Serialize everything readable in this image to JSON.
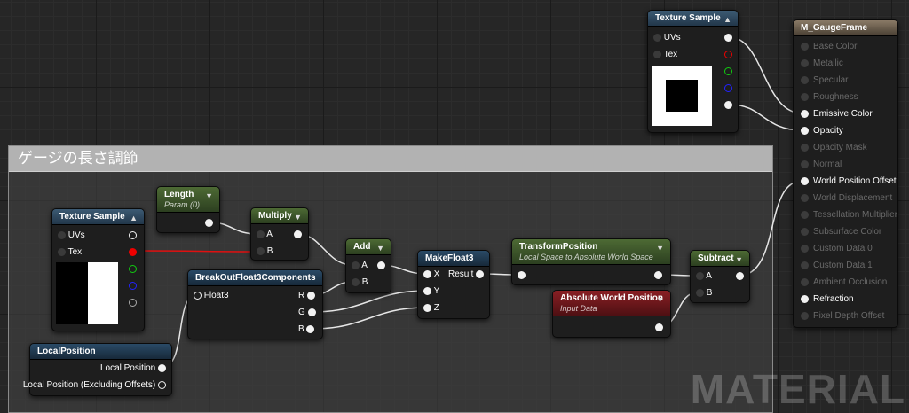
{
  "comment": {
    "title": "ゲージの長さ調節"
  },
  "watermark": "MATERIAL",
  "nodes": {
    "tex_top": {
      "title": "Texture Sample",
      "uvs": "UVs",
      "tex": "Tex"
    },
    "tex_left": {
      "title": "Texture Sample",
      "uvs": "UVs",
      "tex": "Tex"
    },
    "length": {
      "title": "Length",
      "subtitle": "Param (0)"
    },
    "multiply": {
      "title": "Multiply",
      "a": "A",
      "b": "B"
    },
    "add": {
      "title": "Add",
      "a": "A",
      "b": "B"
    },
    "breakout": {
      "title": "BreakOutFloat3Components",
      "in": "Float3",
      "r": "R",
      "g": "G",
      "b": "B"
    },
    "makefloat3": {
      "title": "MakeFloat3",
      "x": "X",
      "y": "Y",
      "z": "Z",
      "result": "Result"
    },
    "transform": {
      "title": "TransformPosition",
      "subtitle": "Local Space to Absolute World Space"
    },
    "absworld": {
      "title": "Absolute World Position",
      "subtitle": "Input Data"
    },
    "subtract": {
      "title": "Subtract",
      "a": "A",
      "b": "B"
    },
    "localpos": {
      "title": "LocalPosition",
      "out1": "Local Position",
      "out2": "Local Position (Excluding Offsets)"
    },
    "material": {
      "title": "M_GaugeFrame",
      "inputs": [
        {
          "label": "Base Color",
          "active": false
        },
        {
          "label": "Metallic",
          "active": false
        },
        {
          "label": "Specular",
          "active": false
        },
        {
          "label": "Roughness",
          "active": false
        },
        {
          "label": "Emissive Color",
          "active": true
        },
        {
          "label": "Opacity",
          "active": true
        },
        {
          "label": "Opacity Mask",
          "active": false
        },
        {
          "label": "Normal",
          "active": false
        },
        {
          "label": "World Position Offset",
          "active": true
        },
        {
          "label": "World Displacement",
          "active": false
        },
        {
          "label": "Tessellation Multiplier",
          "active": false
        },
        {
          "label": "Subsurface Color",
          "active": false
        },
        {
          "label": "Custom Data 0",
          "active": false
        },
        {
          "label": "Custom Data 1",
          "active": false
        },
        {
          "label": "Ambient Occlusion",
          "active": false
        },
        {
          "label": "Refraction",
          "active": true
        },
        {
          "label": "Pixel Depth Offset",
          "active": false
        }
      ]
    }
  }
}
